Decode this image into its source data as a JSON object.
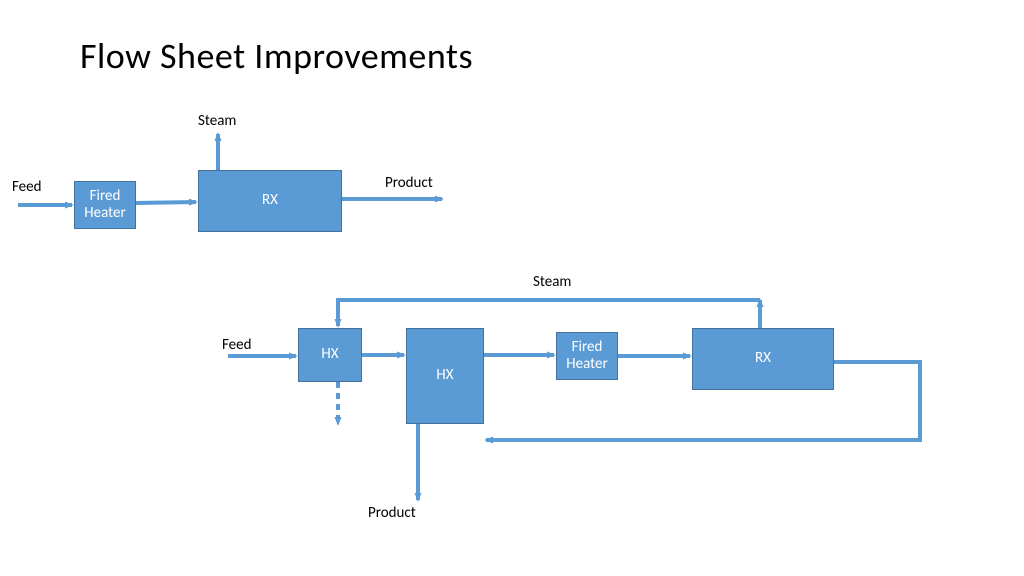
{
  "title": "Flow Sheet Improvements",
  "top": {
    "feed": "Feed",
    "steam": "Steam",
    "product": "Product",
    "fired_heater": "Fired\nHeater",
    "rx": "RX"
  },
  "bottom": {
    "feed": "Feed",
    "steam": "Steam",
    "product": "Product",
    "hx1": "HX",
    "hx2": "HX",
    "fired_heater": "Fired\nHeater",
    "rx": "RX"
  },
  "colors": {
    "box_fill": "#5b9bd5",
    "box_border": "#41719c",
    "arrow": "#5b9bd5"
  }
}
